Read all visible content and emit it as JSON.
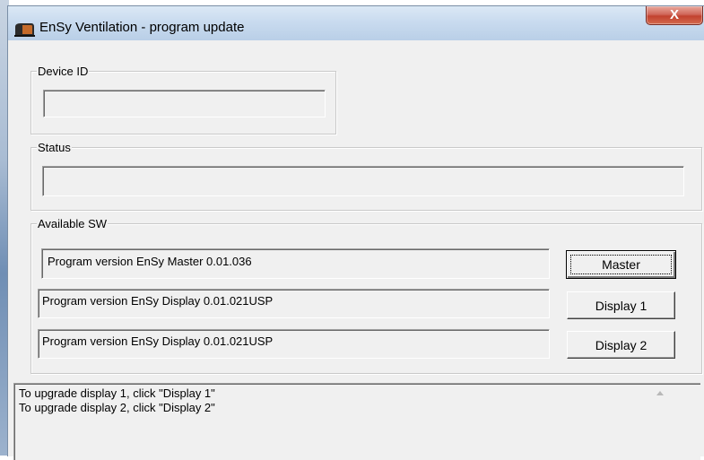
{
  "window": {
    "title": "EnSy Ventilation - program update",
    "close_label": "X"
  },
  "device_id": {
    "label": "Device ID",
    "value": ""
  },
  "status": {
    "label": "Status",
    "value": ""
  },
  "available_sw": {
    "label": "Available SW",
    "items": [
      {
        "version": "Program version EnSy Master 0.01.036",
        "button": "Master"
      },
      {
        "version": "Program version EnSy Display 0.01.021USP",
        "button": "Display 1"
      },
      {
        "version": "Program version EnSy Display 0.01.021USP",
        "button": "Display 2"
      }
    ]
  },
  "log": {
    "lines": [
      "To upgrade display 1, click  \"Display 1\"",
      "To upgrade display 2, click  \"Display 2\""
    ]
  },
  "colors": {
    "title_gradient_top": "#dbe8f5",
    "close_button_red": "#c2412f",
    "dialog_face": "#f0f0f0"
  },
  "icons": [
    "app-icon",
    "close-icon",
    "scroll-up-arrow-icon"
  ]
}
